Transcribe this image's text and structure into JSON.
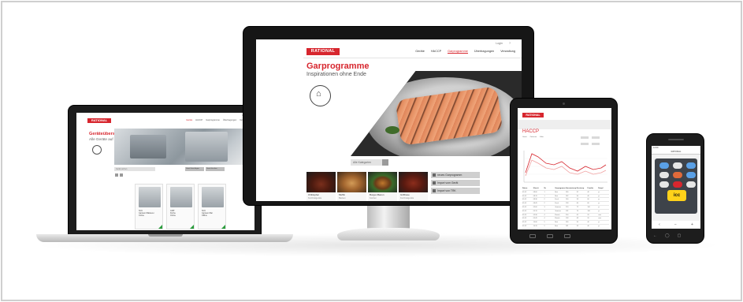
{
  "brand": {
    "logo_text": "RATIONAL",
    "accent": "#d7262e"
  },
  "monitor": {
    "topright_a": "Login",
    "topright_b": "?",
    "nav": [
      "Geräte",
      "HACCP",
      "Garprogramme",
      "Übertragungen",
      "Verwaltung"
    ],
    "active_nav": "Garprogramme",
    "title": "Garprogramme",
    "subtitle": "Inspirationen ohne Ende",
    "search_placeholder": "Alle Kategorien",
    "thumbs": [
      {
        "name": "Chilitopfen",
        "kind": "Kurzbratgeräte",
        "meta": "meat"
      },
      {
        "name": "Muffin",
        "kind": "Backen",
        "meta": "muffin"
      },
      {
        "name": "Burger-Bacon",
        "kind": "Kochen",
        "meta": "burger"
      },
      {
        "name": "Grillhaxe",
        "kind": "Kurzbratgeräte",
        "meta": "ribs"
      }
    ],
    "actions": [
      "neues Garprogramm",
      "Import vom Gerät",
      "Import von TRK"
    ],
    "pager": "• • • •"
  },
  "laptop": {
    "topright": "Login  ?",
    "nav": [
      "Geräte",
      "HACCP",
      "Garprogramme",
      "Übertragungen",
      "Verwaltung"
    ],
    "active_nav": "Geräte",
    "title": "Geräteübersicht",
    "subtitle": "Alle Geräte auf einen Blick",
    "search_placeholder": "Gerät suchen",
    "buttons": [
      "Gerät hinzufügen",
      "Gerät löschen"
    ],
    "cards": [
      {
        "line1": "SCC",
        "line2": "Garraum Bäckerei",
        "line3": "Online"
      },
      {
        "line1": "CMP",
        "line2": "Küche",
        "line3": "Online"
      },
      {
        "line1": "SCC",
        "line2": "Garraum Bar",
        "line3": "Offline"
      }
    ]
  },
  "tablet": {
    "title": "HACCP",
    "fields": [
      "Gerät",
      "Zeitraum",
      "Filter"
    ],
    "table_head": [
      "Datum",
      "Uhrzeit",
      "Nr.",
      "Garprogramm",
      "Garraumtemp.",
      "Kerntemp.",
      "Feuchte",
      "Dampf"
    ],
    "table_rows": [
      [
        "01.03",
        "08:00",
        "1",
        "Brot",
        "180",
        "92",
        "40",
        "ja"
      ],
      [
        "01.03",
        "08:15",
        "1",
        "Brot",
        "182",
        "94",
        "40",
        "ja"
      ],
      [
        "01.03",
        "08:30",
        "2",
        "Fisch",
        "160",
        "58",
        "60",
        "ja"
      ],
      [
        "01.03",
        "08:45",
        "2",
        "Fisch",
        "158",
        "60",
        "60",
        "ja"
      ],
      [
        "01.03",
        "09:00",
        "3",
        "Gemüse",
        "120",
        "72",
        "100",
        "ja"
      ],
      [
        "01.03",
        "09:15",
        "3",
        "Gemüse",
        "118",
        "74",
        "100",
        "ja"
      ],
      [
        "01.03",
        "09:30",
        "4",
        "Fleisch",
        "200",
        "65",
        "20",
        "nein"
      ],
      [
        "01.03",
        "09:45",
        "4",
        "Fleisch",
        "198",
        "68",
        "20",
        "nein"
      ],
      [
        "01.03",
        "10:00",
        "5",
        "Brot",
        "180",
        "90",
        "40",
        "ja"
      ],
      [
        "01.03",
        "10:15",
        "5",
        "Brot",
        "181",
        "93",
        "40",
        "ja"
      ],
      [
        "01.03",
        "10:30",
        "6",
        "Fisch",
        "160",
        "59",
        "60",
        "ja"
      ]
    ],
    "series_colors": [
      "#d7262e",
      "#f0a0a0"
    ]
  },
  "phone": {
    "status": "12:00",
    "header": "RATIONAL",
    "icc_label": "icc",
    "icon_colors": [
      "#5aa0e6",
      "#e6e6e6",
      "#5aa0e6",
      "#e6e6e6",
      "#e06a3a",
      "#5aa0e6",
      "#e6e6e6",
      "#d7262e",
      "#e6e6e6"
    ],
    "bottom_keys": [
      "←",
      "◯",
      "▢"
    ]
  }
}
